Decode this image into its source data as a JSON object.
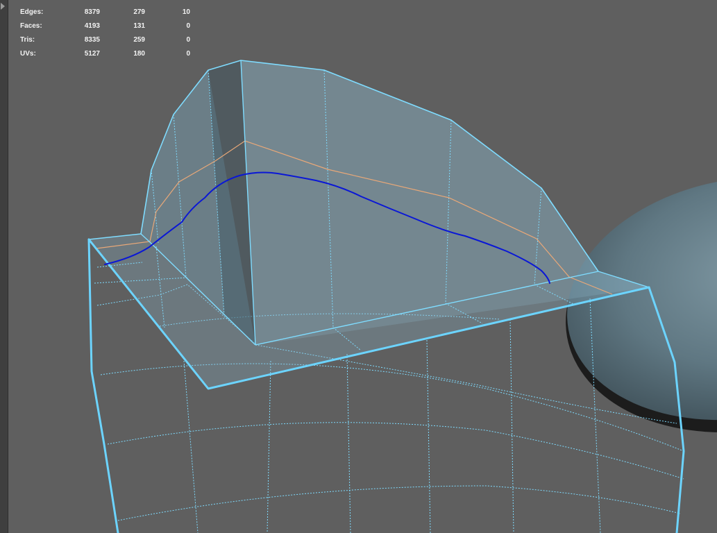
{
  "viewport": {
    "stats": [
      {
        "label": "Edges:",
        "a": "8379",
        "b": "279",
        "c": "10"
      },
      {
        "label": "Faces:",
        "a": "4193",
        "b": "131",
        "c": "0"
      },
      {
        "label": "Tris:",
        "a": "8335",
        "b": "259",
        "c": "0"
      },
      {
        "label": "UVs:",
        "a": "5127",
        "b": "180",
        "c": "0"
      }
    ],
    "colors": {
      "background": "#5f5f5f",
      "wireframe": "#7fdcff",
      "face_fill": "#8bb4c8",
      "curve": "#0a17d6",
      "edge_loop": "#e9a878",
      "sphere": "#5f7782"
    }
  }
}
